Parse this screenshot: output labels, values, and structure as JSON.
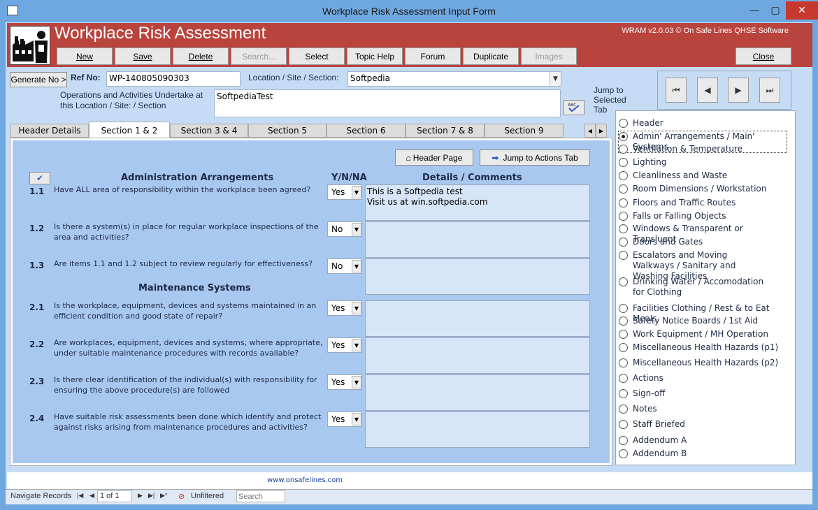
{
  "window": {
    "title": "Workplace Risk Assessment Input Form",
    "minimize": "—",
    "maximize": "▢",
    "close": "✕"
  },
  "header": {
    "app_title": "Workplace Risk Assessment",
    "version": "WRAM v2.0.03 © On Safe Lines QHSE Software",
    "buttons": {
      "new": "New",
      "save": "Save",
      "delete": "Delete",
      "search": "Search...",
      "select": "Select",
      "topic_help": "Topic Help",
      "forum": "Forum",
      "duplicate": "Duplicate",
      "images": "Images",
      "close": "Close"
    }
  },
  "form": {
    "generate_no": "Generate No >",
    "ref_label": "Ref No:",
    "ref_value": "WP-140805090303",
    "location_label": "Location / Site / Section:",
    "location_value": "Softpedia",
    "operations_label": "Operations and Activities Undertake at this Location / Site: / Section",
    "operations_value": "SoftpediaTest",
    "jump_label": "Jump to Selected Tab"
  },
  "tabs": [
    {
      "label": "Header Details"
    },
    {
      "label": "Section 1 & 2"
    },
    {
      "label": "Section 3 & 4"
    },
    {
      "label": "Section 5"
    },
    {
      "label": "Section 6"
    },
    {
      "label": "Section 7 & 8"
    },
    {
      "label": "Section 9"
    }
  ],
  "section": {
    "header_page_btn": "Header Page",
    "jump_actions_btn": "Jump to Actions Tab",
    "admin_heading": "Administration Arrangements",
    "maint_heading": "Maintenance Systems",
    "yn_heading": "Y/N/NA",
    "details_heading": "Details / Comments",
    "questions": [
      {
        "num": "1.1",
        "text": "Have ALL area of responsibility within the workplace been agreed?",
        "answer": "Yes",
        "comment_line1": "This is a Softpedia test",
        "comment_line2": "Visit us at win.softpedia.com"
      },
      {
        "num": "1.2",
        "text": "Is there a system(s) in place for regular workplace inspections of the area and activities?",
        "answer": "No",
        "comment_line1": "",
        "comment_line2": ""
      },
      {
        "num": "1.3",
        "text": "Are items 1.1 and 1.2 subject to review regularly for effectiveness?",
        "answer": "No",
        "comment_line1": "",
        "comment_line2": ""
      },
      {
        "num": "2.1",
        "text": "Is the workplace, equipment, devices and systems maintained in an efficient condition and good state of repair?",
        "answer": "Yes",
        "comment_line1": "",
        "comment_line2": ""
      },
      {
        "num": "2.2",
        "text": "Are workplaces, equipment, devices and systems, where appropriate, under suitable maintenance procedures with records available?",
        "answer": "Yes",
        "comment_line1": "",
        "comment_line2": ""
      },
      {
        "num": "2.3",
        "text": "Is there clear identification of the individual(s) with responsibility for ensuring the above procedure(s) are followed",
        "answer": "Yes",
        "comment_line1": "",
        "comment_line2": ""
      },
      {
        "num": "2.4",
        "text": "Have suitable risk assessments been done which identify and protect against risks arising from maintenance procedures and activities?",
        "answer": "Yes",
        "comment_line1": "",
        "comment_line2": ""
      }
    ]
  },
  "jump_options": [
    {
      "label": "Header"
    },
    {
      "label": "Admin' Arrangements / Main' Systems"
    },
    {
      "label": "Ventilation & Temperature"
    },
    {
      "label": "Lighting"
    },
    {
      "label": "Cleanliness and Waste"
    },
    {
      "label": "Room Dimensions / Workstation"
    },
    {
      "label": "Floors and Traffic Routes"
    },
    {
      "label": "Falls or Falling Objects"
    },
    {
      "label": "Windows & Transparent or Transluent"
    },
    {
      "label": "Doors and Gates"
    },
    {
      "label": "Escalators and Moving Walkways / Sanitary and Washing Facilities"
    },
    {
      "label": "Drinking Water / Accomodation for Clothing"
    },
    {
      "label": "Facilities Clothing / Rest & to Eat Meals"
    },
    {
      "label": "Safety Notice Boards / 1st Aid"
    },
    {
      "label": "Work Equipment / MH Operation"
    },
    {
      "label": "Miscellaneous Health Hazards (p1)"
    },
    {
      "label": "Miscellaneous Health Hazards (p2)"
    },
    {
      "label": "Actions"
    },
    {
      "label": "Sign-off"
    },
    {
      "label": "Notes"
    },
    {
      "label": "Staff Briefed"
    },
    {
      "label": "Addendum A"
    },
    {
      "label": "Addendum B"
    }
  ],
  "footer": {
    "link": "www.onsafelines.com",
    "nav_label": "Navigate Records",
    "record": "1 of 1",
    "filter": "Unfiltered",
    "search_placeholder": "Search"
  }
}
